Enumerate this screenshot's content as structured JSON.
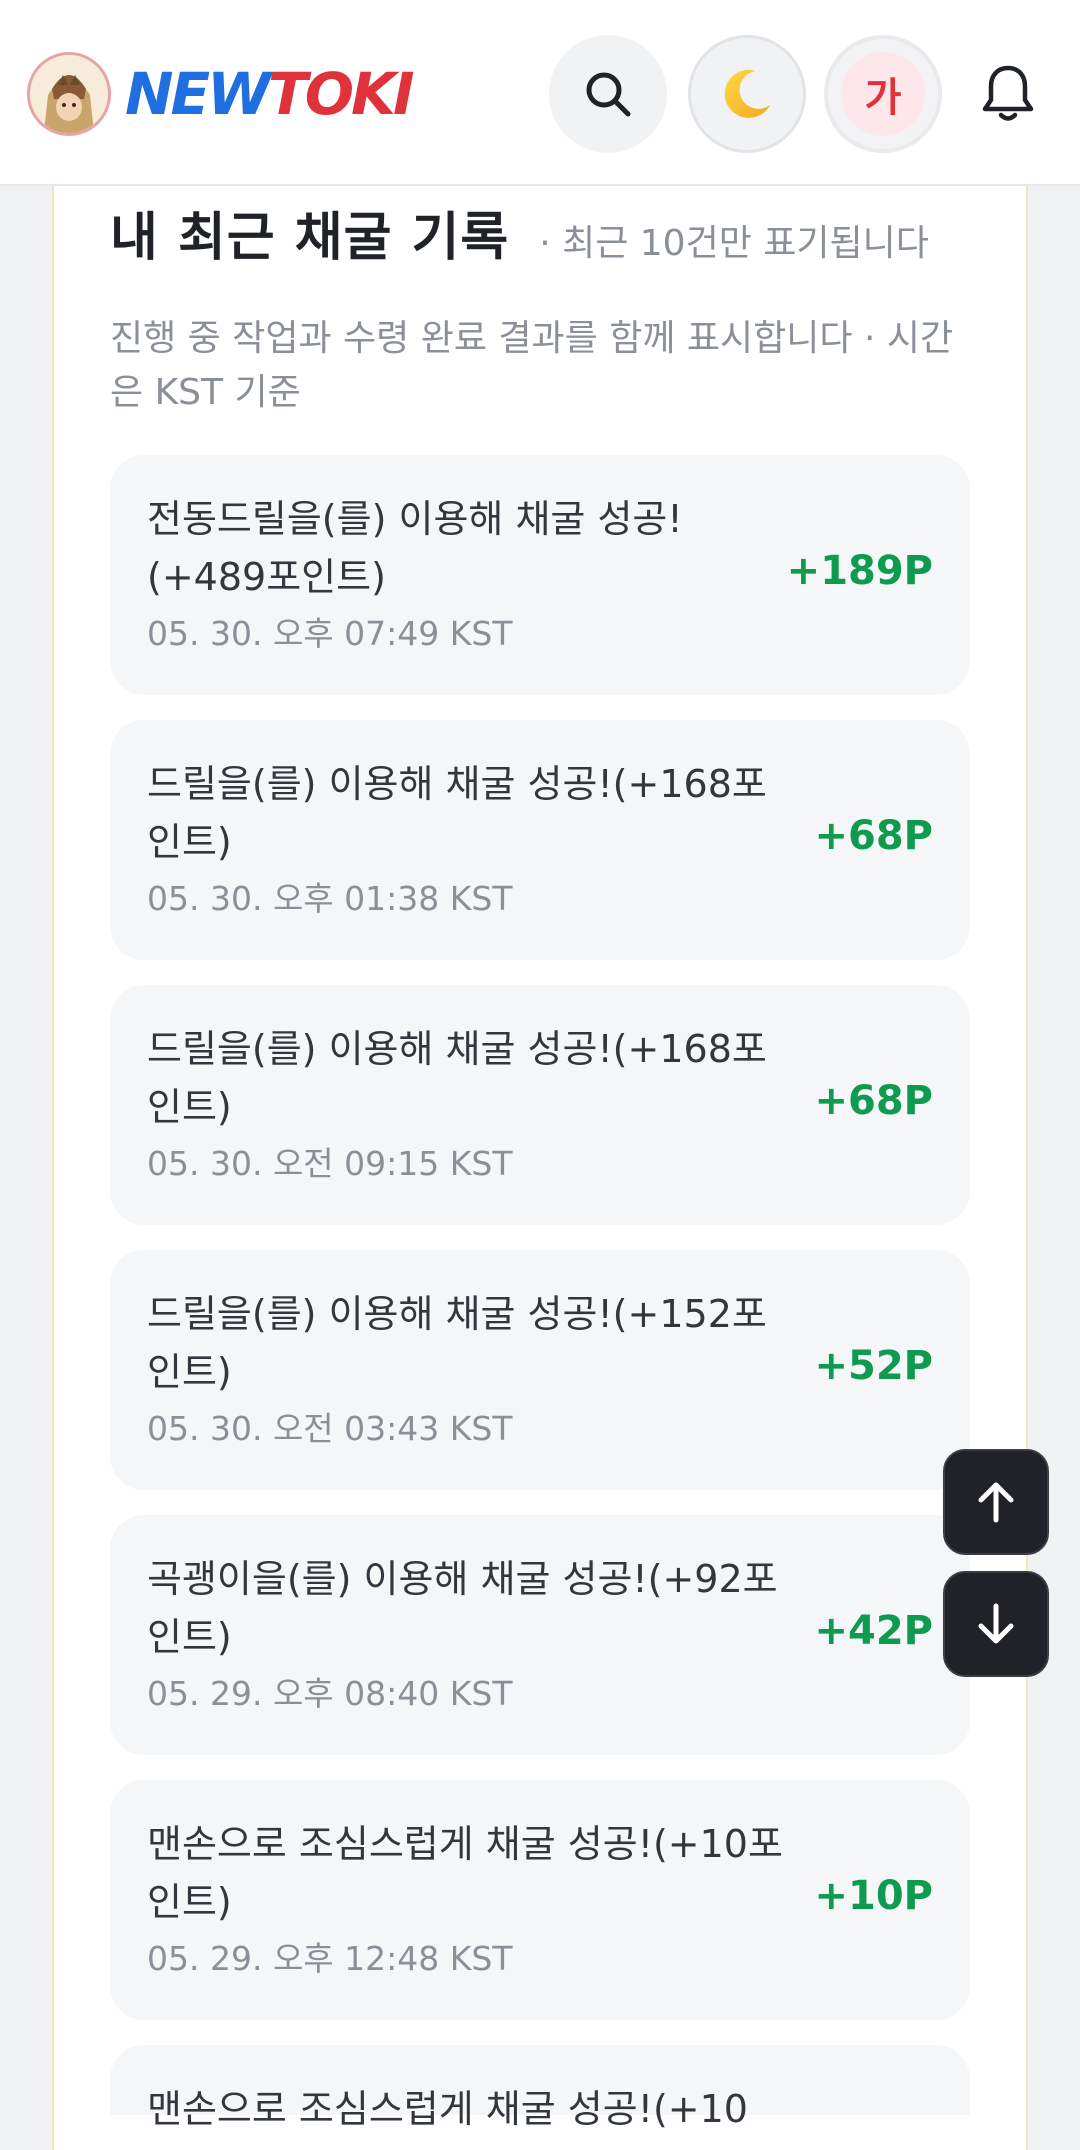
{
  "header": {
    "logo_new": "NEW",
    "logo_toki": "TOKI",
    "font_button_label": "가",
    "icons": {
      "avatar": "character-avatar",
      "search": "search-icon",
      "theme": "moon-icon",
      "notifications": "bell-icon"
    }
  },
  "section": {
    "title": "내 최근 채굴 기록",
    "note": "· 최근 10건만 표기됩니다",
    "description": "진행 중 작업과 수령 완료 결과를 함께 표시합니다 · 시간은 KST 기준"
  },
  "records": [
    {
      "message": "전동드릴을(를) 이용해 채굴 성공!(+489포인트)",
      "time": "05. 30. 오후 07:49 KST",
      "points": "+189P"
    },
    {
      "message": "드릴을(를) 이용해 채굴 성공!(+168포인트)",
      "time": "05. 30. 오후 01:38 KST",
      "points": "+68P"
    },
    {
      "message": "드릴을(를) 이용해 채굴 성공!(+168포인트)",
      "time": "05. 30. 오전 09:15 KST",
      "points": "+68P"
    },
    {
      "message": "드릴을(를) 이용해 채굴 성공!(+152포인트)",
      "time": "05. 30. 오전 03:43 KST",
      "points": "+52P"
    },
    {
      "message": "곡괭이을(를) 이용해 채굴 성공!(+92포인트)",
      "time": "05. 29. 오후 08:40 KST",
      "points": "+42P"
    },
    {
      "message": "맨손으로 조심스럽게 채굴 성공!(+10포인트)",
      "time": "05. 29. 오후 12:48 KST",
      "points": "+10P"
    },
    {
      "message": "맨손으로 조심스럽게 채굴 성공!(+10"
    }
  ],
  "floating": {
    "scroll_top_icon": "arrow-up-icon",
    "scroll_bottom_icon": "arrow-down-icon"
  },
  "colors": {
    "accent_points": "#0e9a4f",
    "logo_blue": "#1f6fe0",
    "logo_red": "#e0323b",
    "fab_background": "#202227"
  }
}
